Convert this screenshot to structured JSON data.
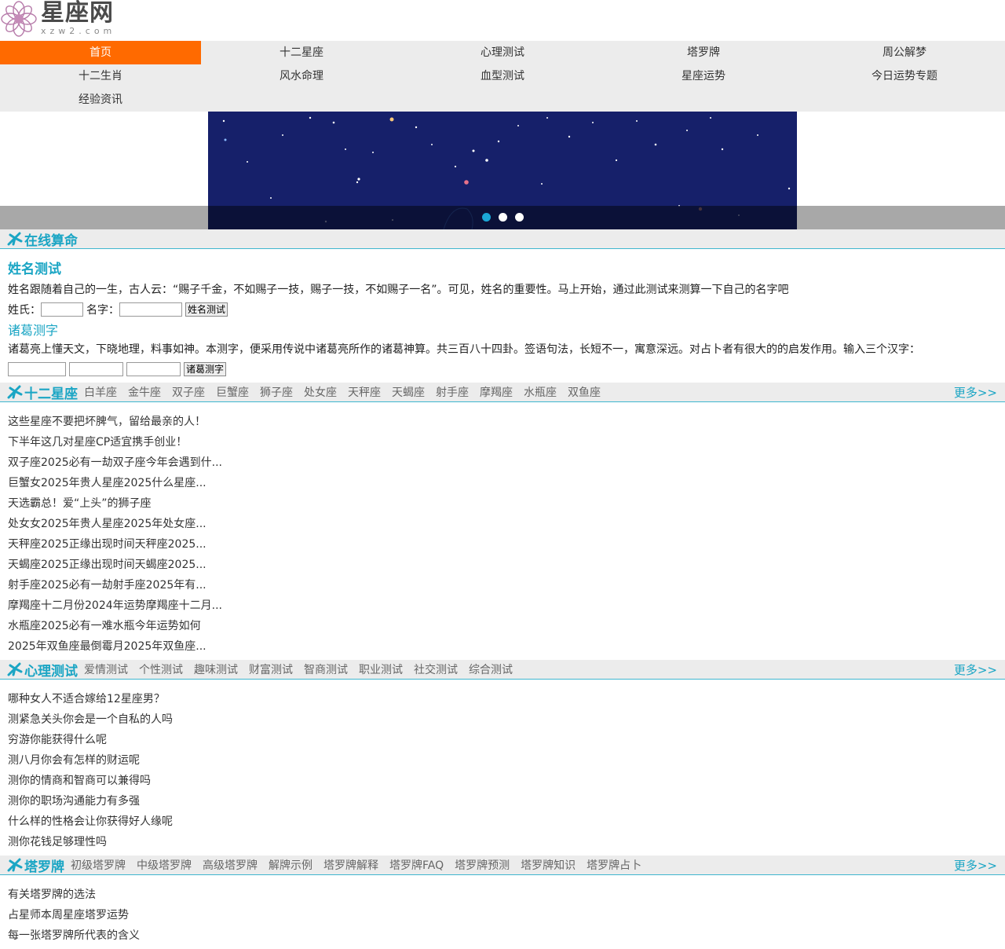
{
  "logo": {
    "cn": "星座网",
    "en": "xzw2.com"
  },
  "nav": [
    {
      "label": "首页",
      "active": true
    },
    {
      "label": "十二星座"
    },
    {
      "label": "心理测试"
    },
    {
      "label": "塔罗牌"
    },
    {
      "label": "周公解梦"
    },
    {
      "label": "十二生肖"
    },
    {
      "label": "风水命理"
    },
    {
      "label": "血型测试"
    },
    {
      "label": "星座运势"
    },
    {
      "label": "今日运势专题"
    },
    {
      "label": "经验资讯"
    }
  ],
  "online": {
    "title": "在线算命",
    "name_test": {
      "title": "姓名测试",
      "desc": "姓名跟随着自己的一生，古人云：“赐子千金，不如赐子一技，赐子一技，不如赐子一名”。可见，姓名的重要性。马上开始，通过此测试来测算一下自己的名字吧",
      "surname_label": "姓氏：",
      "name_label": "名字：",
      "button": "姓名测试"
    },
    "zhuge": {
      "title": "诸葛测字",
      "desc": "诸葛亮上懂天文，下晓地理，料事如神。本测字，便采用传说中诸葛亮所作的诸葛神算。共三百八十四卦。签语句法，长短不一，寓意深远。对占卜者有很大的的启发作用。输入三个汉字：",
      "button": "诸葛测字"
    }
  },
  "zodiac": {
    "title": "十二星座",
    "tabs": [
      "白羊座",
      "金牛座",
      "双子座",
      "巨蟹座",
      "狮子座",
      "处女座",
      "天秤座",
      "天蝎座",
      "射手座",
      "摩羯座",
      "水瓶座",
      "双鱼座"
    ],
    "more": "更多>>",
    "items": [
      "这些星座不要把坏脾气，留给最亲的人！",
      "下半年这几对星座CP适宜携手创业！",
      "双子座2025必有一劫双子座今年会遇到什...",
      "巨蟹女2025年贵人星座2025什么星座...",
      "天选霸总！爱“上头”的狮子座",
      "处女女2025年贵人星座2025年处女座...",
      "天秤座2025正缘出现时间天秤座2025...",
      "天蝎座2025正缘出现时间天蝎座2025...",
      "射手座2025必有一劫射手座2025年有...",
      "摩羯座十二月份2024年运势摩羯座十二月...",
      "水瓶座2025必有一难水瓶今年运势如何",
      "2025年双鱼座最倒霉月2025年双鱼座..."
    ]
  },
  "psych": {
    "title": "心理测试",
    "tabs": [
      "爱情测试",
      "个性测试",
      "趣味测试",
      "财富测试",
      "智商测试",
      "职业测试",
      "社交测试",
      "综合测试"
    ],
    "more": "更多>>",
    "items": [
      "哪种女人不适合嫁给12星座男？",
      "测紧急关头你会是一个自私的人吗",
      "穷游你能获得什么呢",
      "测八月你会有怎样的财运呢",
      "测你的情商和智商可以兼得吗",
      "测你的职场沟通能力有多强",
      "什么样的性格会让你获得好人缘呢",
      "测你花钱足够理性吗"
    ]
  },
  "tarot": {
    "title": "塔罗牌",
    "tabs": [
      "初级塔罗牌",
      "中级塔罗牌",
      "高级塔罗牌",
      "解牌示例",
      "塔罗牌解释",
      "塔罗牌FAQ",
      "塔罗牌预测",
      "塔罗牌知识",
      "塔罗牌占卜"
    ],
    "more": "更多>>",
    "items": [
      "有关塔罗牌的选法",
      "占星师本周星座塔罗运势",
      "每一张塔罗牌所代表的含义"
    ]
  },
  "colors": {
    "accent": "#1aa5c4",
    "nav_active": "#ff6a00",
    "nav_bg": "#ececec"
  }
}
